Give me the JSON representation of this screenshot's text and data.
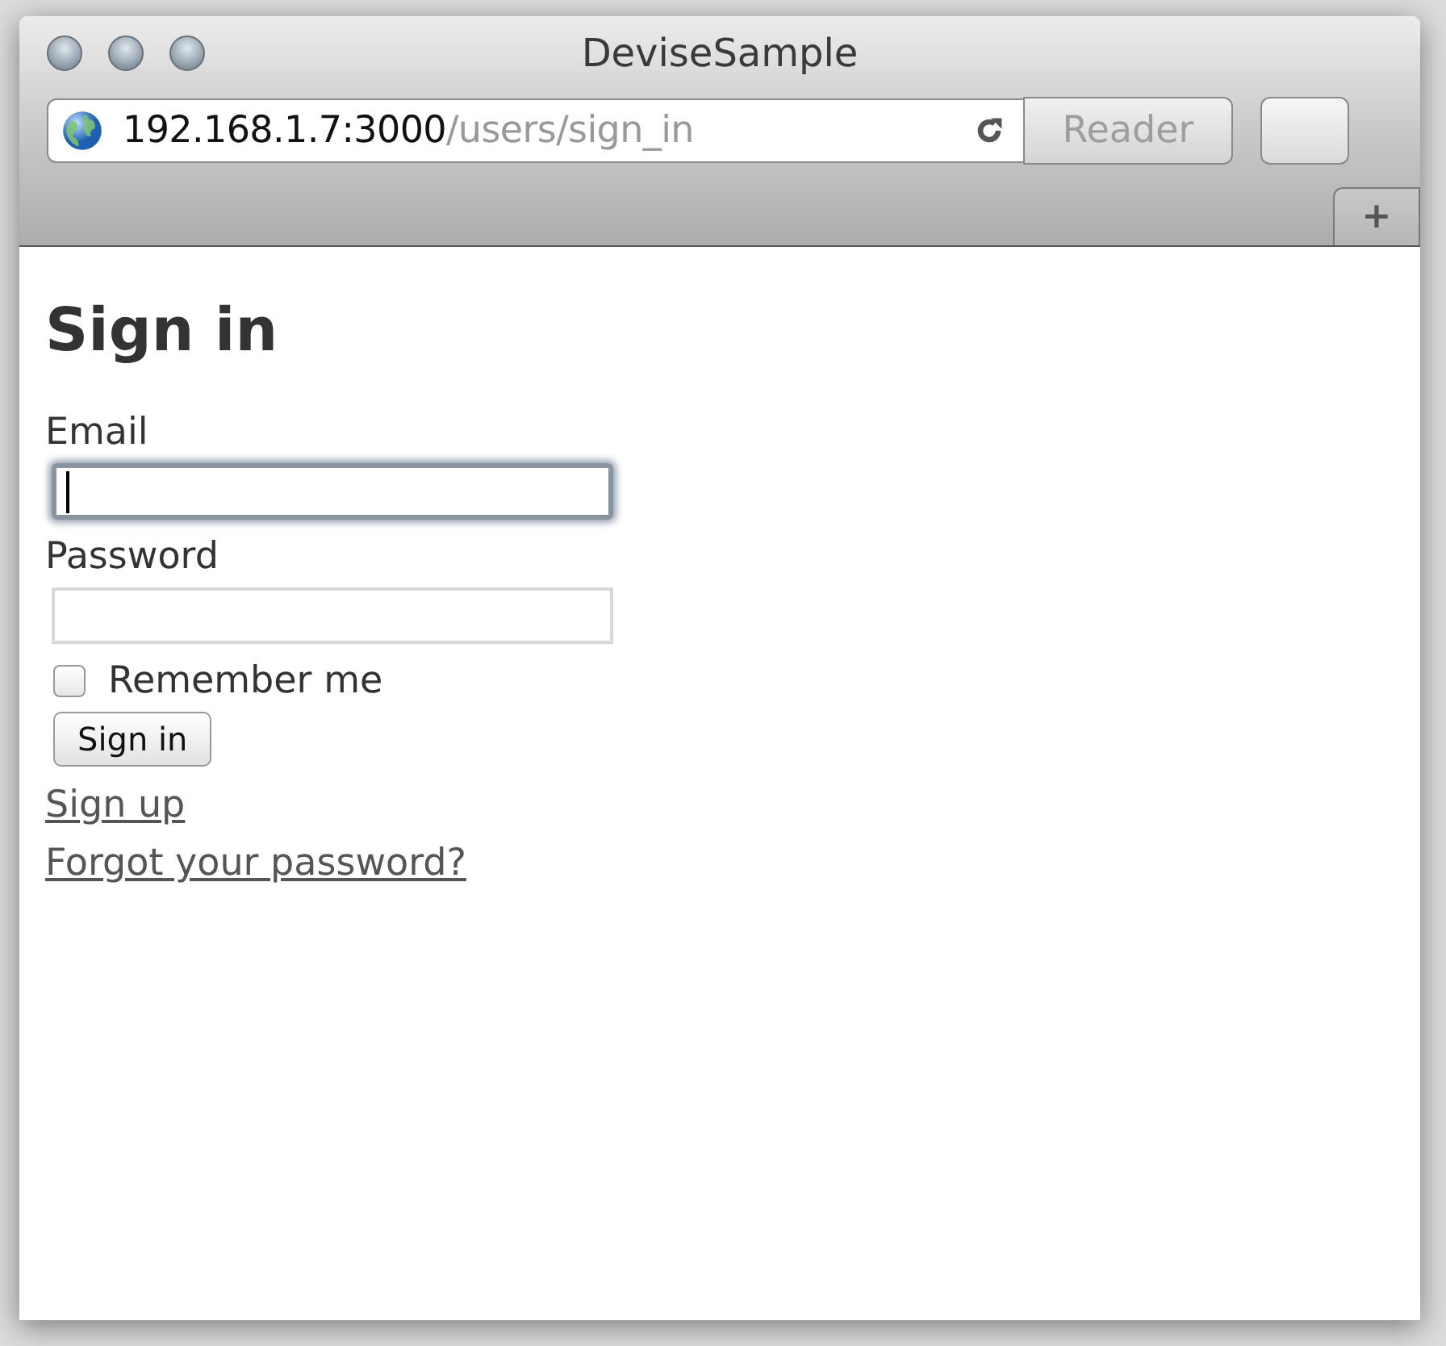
{
  "window": {
    "title": "DeviseSample"
  },
  "address_bar": {
    "host": "192.168.1.7:3000",
    "path": "/users/sign_in"
  },
  "reader_button": {
    "label": "Reader",
    "disabled": true
  },
  "new_tab": {
    "label": "+"
  },
  "page": {
    "heading": "Sign in",
    "fields": [
      {
        "label": "Email",
        "focused": true
      },
      {
        "label": "Password",
        "focused": false
      }
    ],
    "remember": {
      "label": "Remember me",
      "checked": false
    },
    "submit": "Sign in",
    "links": [
      "Sign up",
      "Forgot your password?"
    ]
  }
}
